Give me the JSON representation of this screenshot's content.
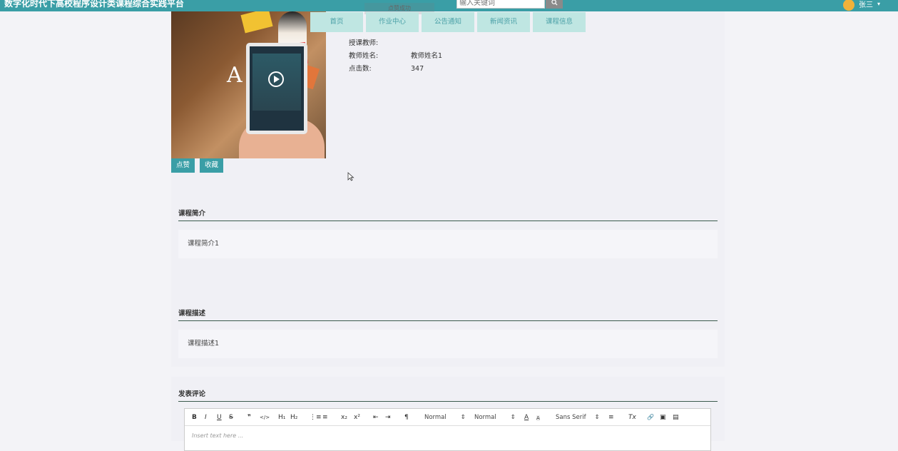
{
  "header": {
    "site_title": "数字化时代下高校程序设计类课程综合实践平台",
    "search_placeholder": "输入关键词",
    "search_icon": "search-icon",
    "user_name": "张三",
    "user_caret": "▾",
    "toast": "点赞成功"
  },
  "nav": {
    "items": [
      {
        "label": "首页"
      },
      {
        "label": "作业中心"
      },
      {
        "label": "公告通知"
      },
      {
        "label": "新闻资讯"
      },
      {
        "label": "课程信息"
      }
    ]
  },
  "course": {
    "teacher_label": "授课教师:",
    "teacher_name_label": "教师姓名:",
    "teacher_name_value": "教师姓名1",
    "clicks_label": "点击数:",
    "clicks_value": "347",
    "like_button": "点赞",
    "favorite_button": "收藏"
  },
  "intro": {
    "title": "课程简介",
    "content": "课程简介1"
  },
  "description": {
    "title": "课程描述",
    "content": "课程描述1"
  },
  "comment": {
    "title": "发表评论",
    "placeholder": "Insert text here ...",
    "toolbar": {
      "bold": "B",
      "italic": "I",
      "underline": "U",
      "strike": "S",
      "quote": "❞",
      "code": "</>",
      "h1": "H₁",
      "h2": "H₂",
      "ordered_list": "⋮≡",
      "bullet_list": "≡",
      "subscript": "x₂",
      "superscript": "x²",
      "outdent": "⇤",
      "indent": "⇥",
      "direction": "¶",
      "size_select": "Normal",
      "header_select": "Normal",
      "font_select": "Sans Serif",
      "text_color": "A",
      "bg_color": "A",
      "align": "≡",
      "clean": "Tx",
      "link": "🔗",
      "image": "▣",
      "video": "▤"
    }
  }
}
